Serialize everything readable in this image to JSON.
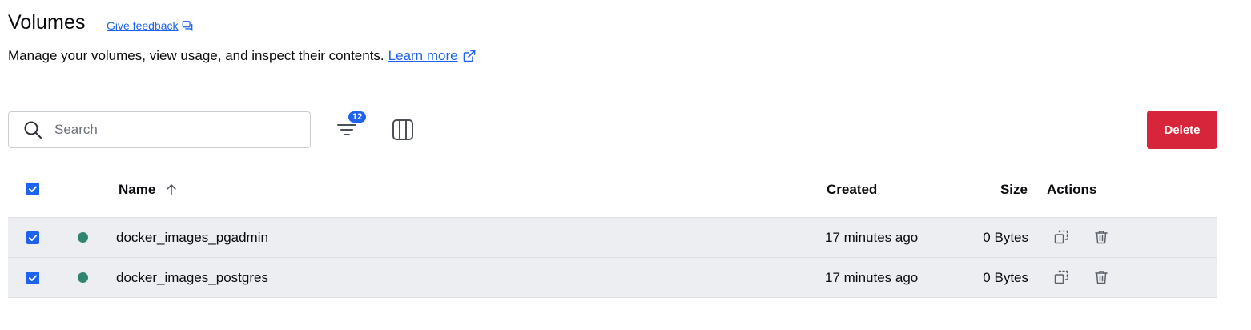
{
  "page": {
    "title": "Volumes",
    "feedback_label": "Give feedback",
    "subtitle": "Manage your volumes, view usage, and inspect their contents.",
    "learn_more_label": "Learn more"
  },
  "toolbar": {
    "search_placeholder": "Search",
    "filter_count": "12",
    "delete_label": "Delete"
  },
  "table": {
    "headers": {
      "name": "Name",
      "created": "Created",
      "size": "Size",
      "actions": "Actions"
    },
    "rows": [
      {
        "name": "docker_images_pgadmin",
        "created": "17 minutes ago",
        "size": "0 Bytes",
        "status": "in-use",
        "selected": true
      },
      {
        "name": "docker_images_postgres",
        "created": "17 minutes ago",
        "size": "0 Bytes",
        "status": "in-use",
        "selected": true
      }
    ]
  },
  "colors": {
    "accent": "#1d63ed",
    "danger": "#d7263b",
    "status_in_use": "#2e8570",
    "selected_row": "#eceef2"
  },
  "icons": {
    "feedback": "feedback-icon",
    "learn_more": "external-link-icon",
    "search": "search-icon",
    "filter": "filter-icon",
    "columns": "columns-icon",
    "sort": "arrow-up-icon",
    "copy": "clone-icon",
    "delete": "trash-icon"
  }
}
